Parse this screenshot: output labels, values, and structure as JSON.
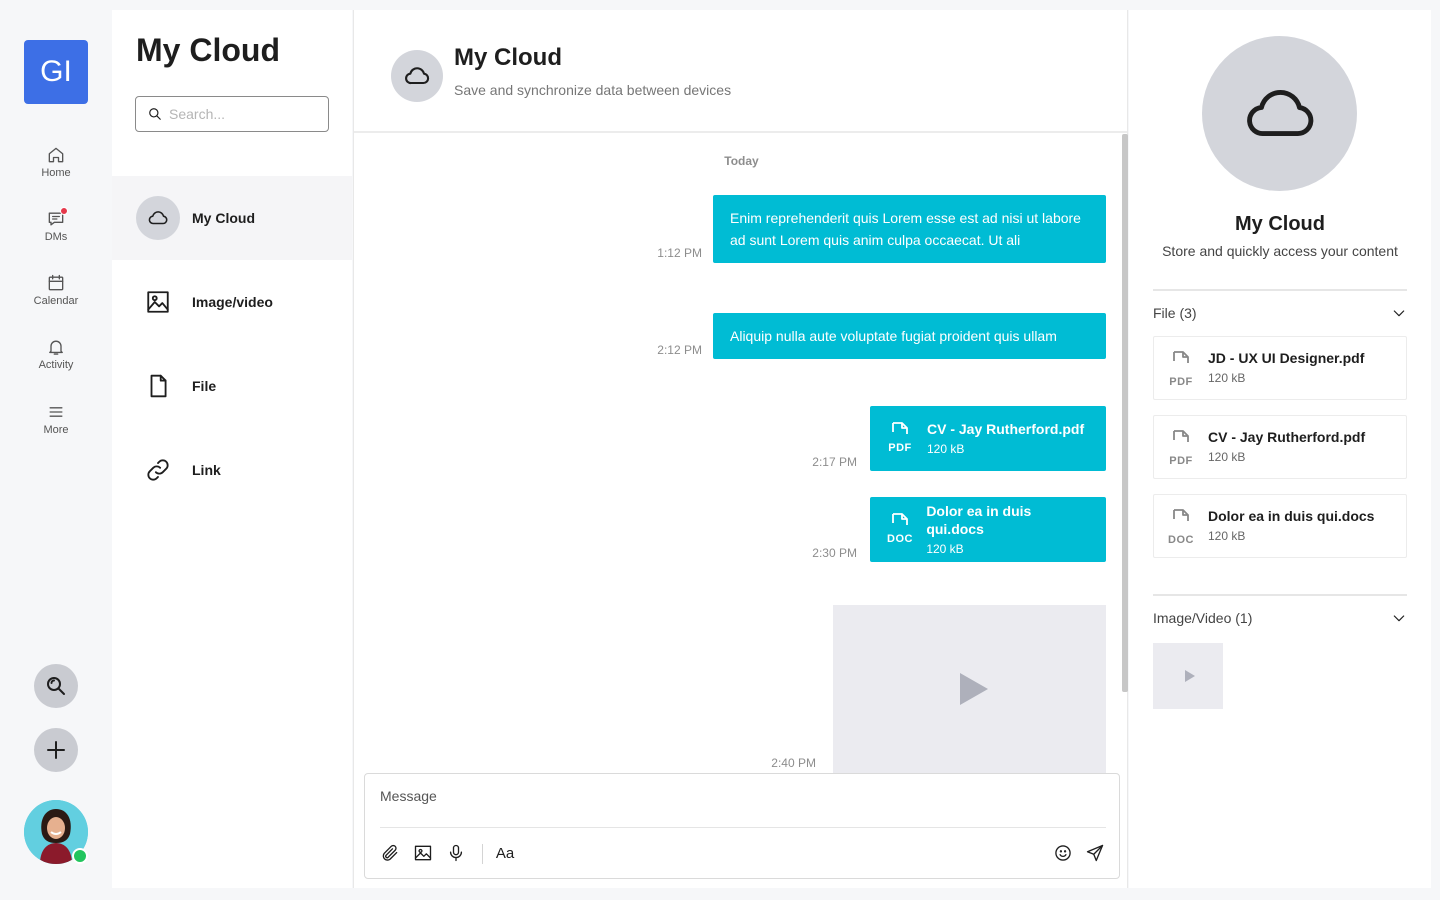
{
  "rail": {
    "brand": "GI",
    "nav": [
      {
        "label": "Home",
        "icon": "home-icon"
      },
      {
        "label": "DMs",
        "icon": "chat-icon"
      },
      {
        "label": "Calendar",
        "icon": "calendar-icon"
      },
      {
        "label": "Activity",
        "icon": "bell-icon"
      },
      {
        "label": "More",
        "icon": "menu-icon"
      }
    ]
  },
  "panel": {
    "title": "My Cloud",
    "search_placeholder": "Search...",
    "items": [
      {
        "label": "My Cloud",
        "icon": "cloud-icon",
        "active": true
      },
      {
        "label": "Image/video",
        "icon": "image-icon"
      },
      {
        "label": "File",
        "icon": "file-icon"
      },
      {
        "label": "Link",
        "icon": "link-icon"
      }
    ]
  },
  "chat": {
    "title": "My Cloud",
    "subtitle": "Save and synchronize data between devices",
    "day_label": "Today",
    "messages": [
      {
        "time": "1:12 PM",
        "type": "text",
        "text": "Enim reprehenderit quis Lorem esse est ad nisi ut labore ad sunt Lorem quis anim culpa occaecat. Ut ali"
      },
      {
        "time": "2:12 PM",
        "type": "text",
        "text": "Aliquip nulla aute voluptate fugiat proident quis ullam"
      },
      {
        "time": "2:17 PM",
        "type": "file",
        "filetype": "PDF",
        "name": "CV - Jay Rutherford.pdf",
        "size": "120 kB"
      },
      {
        "time": "2:30 PM",
        "type": "file",
        "filetype": "DOC",
        "name": "Dolor ea in duis qui.docs",
        "size": "120 kB"
      },
      {
        "time": "2:40 PM",
        "type": "video"
      }
    ],
    "composer_placeholder": "Message",
    "format_label": "Aa"
  },
  "info": {
    "title": "My Cloud",
    "subtitle": "Store and quickly access your content",
    "files_header": "File (3)",
    "files": [
      {
        "filetype": "PDF",
        "name": "JD - UX UI Designer.pdf",
        "size": "120 kB"
      },
      {
        "filetype": "PDF",
        "name": "CV - Jay Rutherford.pdf",
        "size": "120 kB"
      },
      {
        "filetype": "DOC",
        "name": "Dolor ea in duis qui.docs",
        "size": "120 kB"
      }
    ],
    "media_header": "Image/Video (1)"
  },
  "colors": {
    "accent": "#00bcd4",
    "brand": "#3d6fe6",
    "online": "#22c55e",
    "notification": "#e5384b"
  }
}
